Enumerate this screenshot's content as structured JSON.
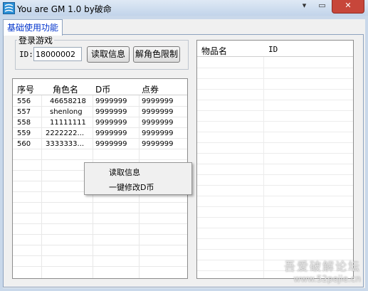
{
  "window": {
    "title": "You are GM 1.0 by破命",
    "min_label": "▾",
    "max_label": "▭",
    "close_label": "✕",
    "icon": "app-logo-icon"
  },
  "tab": {
    "label": "基础使用功能"
  },
  "login": {
    "group_title": "登录游戏",
    "id_label": "ID:",
    "id_value": "18000002",
    "read_button": "读取信息",
    "unlock_button": "解角色限制"
  },
  "roles_table": {
    "headers": [
      "序号",
      "角色名",
      "D币",
      "点券"
    ],
    "rows": [
      [
        "556",
        "46658218",
        "9999999",
        "9999999"
      ],
      [
        "557",
        "shenlong",
        "9999999",
        "9999999"
      ],
      [
        "558",
        "11111111",
        "9999999",
        "9999999"
      ],
      [
        "559",
        "2222222...",
        "9999999",
        "9999999"
      ],
      [
        "560",
        "3333333...",
        "9999999",
        "9999999"
      ]
    ]
  },
  "items_table": {
    "headers": [
      "物品名",
      "ID"
    ]
  },
  "context_menu": {
    "items": [
      "读取信息",
      "一键修改D币"
    ]
  },
  "watermark": {
    "line1": "吾爱破解论坛",
    "line2": "www.52pojie.cn"
  }
}
